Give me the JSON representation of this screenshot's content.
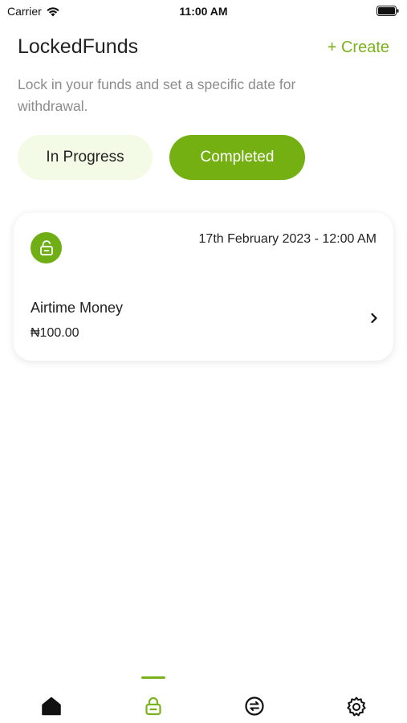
{
  "status_bar": {
    "carrier": "Carrier",
    "time": "11:00 AM"
  },
  "header": {
    "title": "LockedFunds",
    "create_label": "+ Create"
  },
  "subtitle": "Lock in your funds and set a specific date for withdrawal.",
  "tabs": [
    {
      "label": "In Progress",
      "active": false
    },
    {
      "label": "Completed",
      "active": true
    }
  ],
  "cards": [
    {
      "date": "17th February 2023 - 12:00 AM",
      "name": "Airtime Money",
      "amount": "₦100.00"
    }
  ],
  "bottom_nav": [
    {
      "icon": "home-icon"
    },
    {
      "icon": "lock-icon",
      "active": true
    },
    {
      "icon": "exchange-icon"
    },
    {
      "icon": "settings-icon"
    }
  ],
  "colors": {
    "accent": "#74b012",
    "accent_light": "#f3fbe6",
    "text": "#222222",
    "muted": "#8c8c8c"
  }
}
